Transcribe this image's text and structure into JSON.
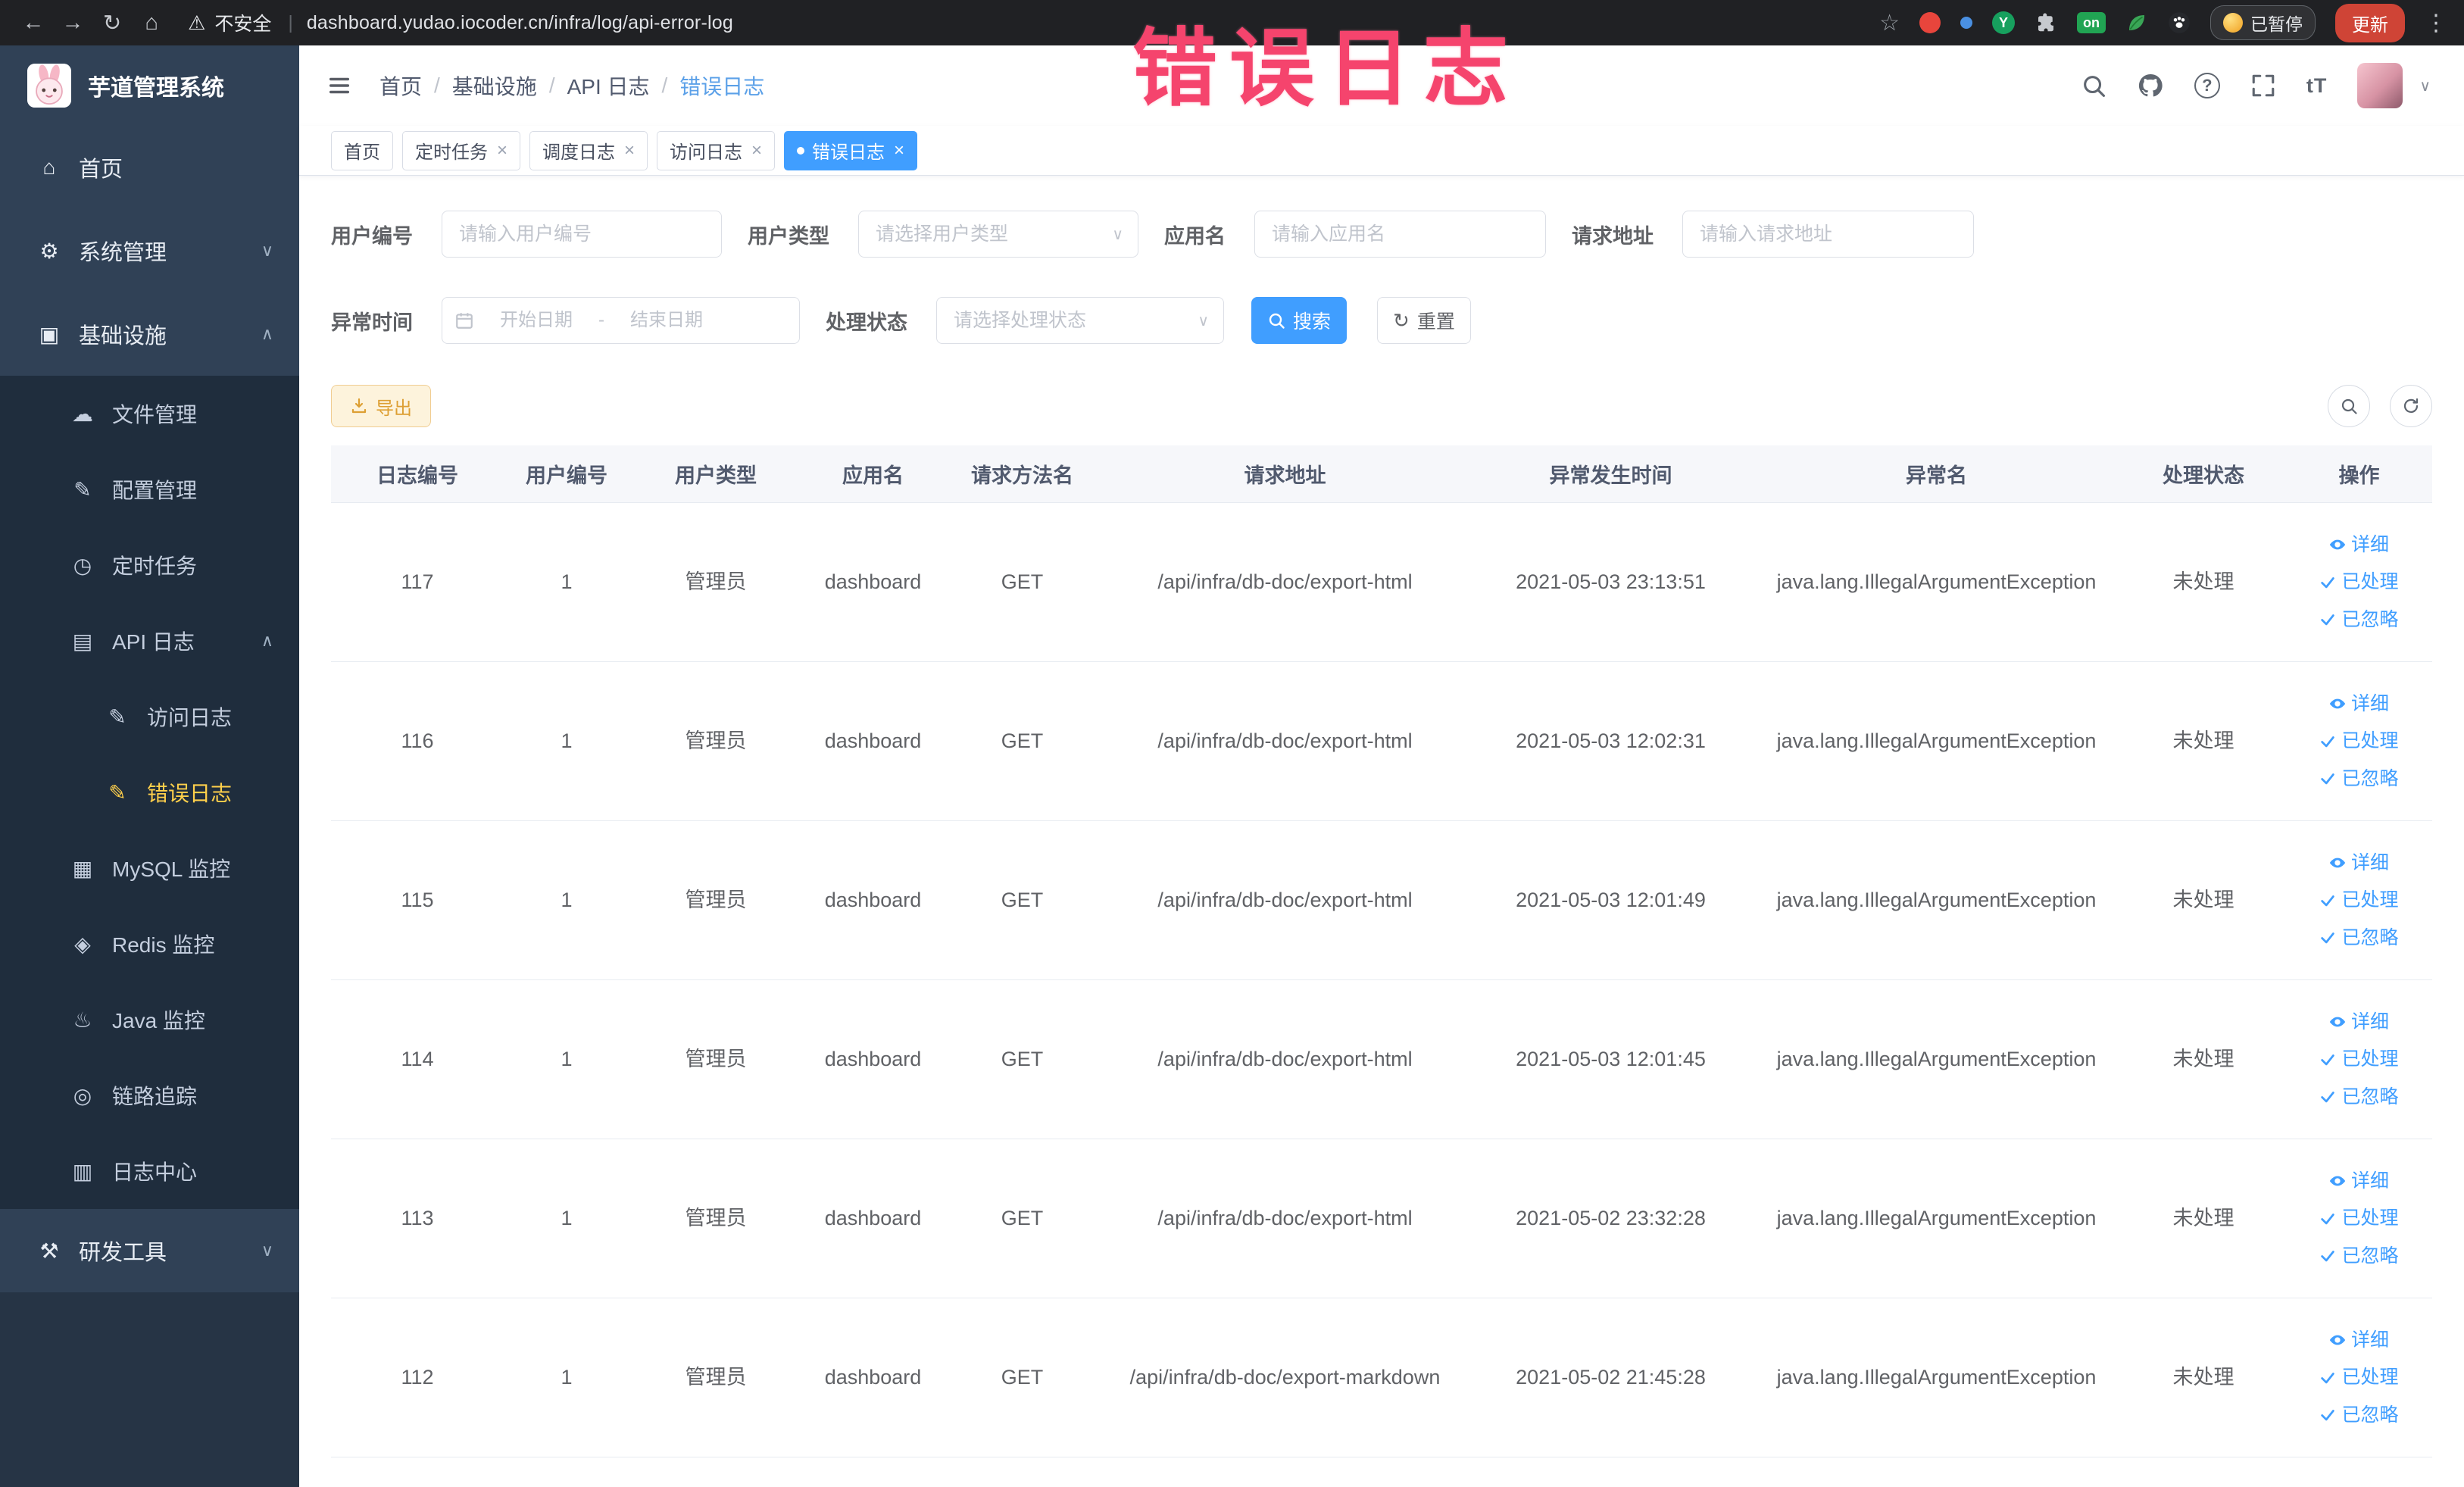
{
  "browser": {
    "security_label": "不安全",
    "url": "dashboard.yudao.iocoder.cn/infra/log/api-error-log",
    "extension_on_badge": "on",
    "extension_y_badge": "Y",
    "paused_badge": "已暂停",
    "update_button": "更新"
  },
  "annotation": "错误日志",
  "sidebar": {
    "logo_title": "芋道管理系统",
    "items": [
      {
        "label": "首页",
        "name": "sidebar-item-home",
        "icon": "home-icon",
        "level": 1
      },
      {
        "label": "系统管理",
        "name": "sidebar-item-system-management",
        "icon": "gear-icon",
        "level": 1,
        "arrow": "down"
      },
      {
        "label": "基础设施",
        "name": "sidebar-item-infrastructure",
        "icon": "infrastructure-icon",
        "level": 1,
        "arrow": "up"
      },
      {
        "label": "文件管理",
        "name": "sidebar-item-file-management",
        "icon": "cloud-icon",
        "level": 2
      },
      {
        "label": "配置管理",
        "name": "sidebar-item-config-management",
        "icon": "edit-icon",
        "level": 2
      },
      {
        "label": "定时任务",
        "name": "sidebar-item-scheduled-tasks",
        "icon": "timer-icon",
        "level": 2
      },
      {
        "label": "API 日志",
        "name": "sidebar-item-api-log",
        "icon": "api-log-icon",
        "level": 2,
        "arrow": "up"
      },
      {
        "label": "访问日志",
        "name": "sidebar-item-access-log",
        "icon": "log-doc-icon",
        "level": 3
      },
      {
        "label": "错误日志",
        "name": "sidebar-item-error-log",
        "icon": "log-doc-icon",
        "level": 3,
        "active": true
      },
      {
        "label": "MySQL 监控",
        "name": "sidebar-item-mysql-monitor",
        "icon": "database-icon",
        "level": 2
      },
      {
        "label": "Redis 监控",
        "name": "sidebar-item-redis-monitor",
        "icon": "redis-icon",
        "level": 2
      },
      {
        "label": "Java 监控",
        "name": "sidebar-item-java-monitor",
        "icon": "java-icon",
        "level": 2
      },
      {
        "label": "链路追踪",
        "name": "sidebar-item-trace",
        "icon": "trace-icon",
        "level": 2
      },
      {
        "label": "日志中心",
        "name": "sidebar-item-log-center",
        "icon": "log-center-icon",
        "level": 2
      },
      {
        "label": "研发工具",
        "name": "sidebar-item-dev-tools",
        "icon": "tools-icon",
        "level": 1,
        "arrow": "down"
      }
    ]
  },
  "header": {
    "breadcrumb": [
      "首页",
      "基础设施",
      "API 日志",
      "错误日志"
    ],
    "font_icon_label": "tT"
  },
  "tabs": [
    {
      "label": "首页",
      "name": "tab-home",
      "closable": false,
      "active": false
    },
    {
      "label": "定时任务",
      "name": "tab-scheduled-tasks",
      "closable": true,
      "active": false
    },
    {
      "label": "调度日志",
      "name": "tab-schedule-log",
      "closable": true,
      "active": false
    },
    {
      "label": "访问日志",
      "name": "tab-access-log",
      "closable": true,
      "active": false
    },
    {
      "label": "错误日志",
      "name": "tab-error-log",
      "closable": true,
      "active": true
    }
  ],
  "filters": {
    "user_id": {
      "label": "用户编号",
      "placeholder": "请输入用户编号"
    },
    "user_type": {
      "label": "用户类型",
      "placeholder": "请选择用户类型"
    },
    "app_name": {
      "label": "应用名",
      "placeholder": "请输入应用名"
    },
    "request_url": {
      "label": "请求地址",
      "placeholder": "请输入请求地址"
    },
    "exception_time": {
      "label": "异常时间",
      "start_placeholder": "开始日期",
      "separator": "-",
      "end_placeholder": "结束日期"
    },
    "process_status": {
      "label": "处理状态",
      "placeholder": "请选择处理状态"
    },
    "search_button": "搜索",
    "reset_button": "重置"
  },
  "toolbar": {
    "export_button": "导出"
  },
  "table": {
    "headers": [
      "日志编号",
      "用户编号",
      "用户类型",
      "应用名",
      "请求方法名",
      "请求地址",
      "异常发生时间",
      "异常名",
      "处理状态",
      "操作"
    ],
    "actions": {
      "detail": "详细",
      "processed": "已处理",
      "ignored": "已忽略"
    },
    "rows": [
      {
        "id": "117",
        "user_id": "1",
        "user_type": "管理员",
        "app": "dashboard",
        "method": "GET",
        "url": "/api/infra/db-doc/export-html",
        "time": "2021-05-03 23:13:51",
        "exception": "java.lang.IllegalArgumentException",
        "status": "未处理"
      },
      {
        "id": "116",
        "user_id": "1",
        "user_type": "管理员",
        "app": "dashboard",
        "method": "GET",
        "url": "/api/infra/db-doc/export-html",
        "time": "2021-05-03 12:02:31",
        "exception": "java.lang.IllegalArgumentException",
        "status": "未处理"
      },
      {
        "id": "115",
        "user_id": "1",
        "user_type": "管理员",
        "app": "dashboard",
        "method": "GET",
        "url": "/api/infra/db-doc/export-html",
        "time": "2021-05-03 12:01:49",
        "exception": "java.lang.IllegalArgumentException",
        "status": "未处理"
      },
      {
        "id": "114",
        "user_id": "1",
        "user_type": "管理员",
        "app": "dashboard",
        "method": "GET",
        "url": "/api/infra/db-doc/export-html",
        "time": "2021-05-03 12:01:45",
        "exception": "java.lang.IllegalArgumentException",
        "status": "未处理"
      },
      {
        "id": "113",
        "user_id": "1",
        "user_type": "管理员",
        "app": "dashboard",
        "method": "GET",
        "url": "/api/infra/db-doc/export-html",
        "time": "2021-05-02 23:32:28",
        "exception": "java.lang.IllegalArgumentException",
        "status": "未处理"
      },
      {
        "id": "112",
        "user_id": "1",
        "user_type": "管理员",
        "app": "dashboard",
        "method": "GET",
        "url": "/api/infra/db-doc/export-markdown",
        "time": "2021-05-02 21:45:28",
        "exception": "java.lang.IllegalArgumentException",
        "status": "未处理"
      }
    ]
  },
  "colors": {
    "accent": "#409eff",
    "sidebar_bg": "#304156",
    "submenu_bg": "#1f2d3d",
    "active_menu_text": "#ffd04b",
    "warning": "#e6a23c",
    "annotation": "#f5446d"
  }
}
